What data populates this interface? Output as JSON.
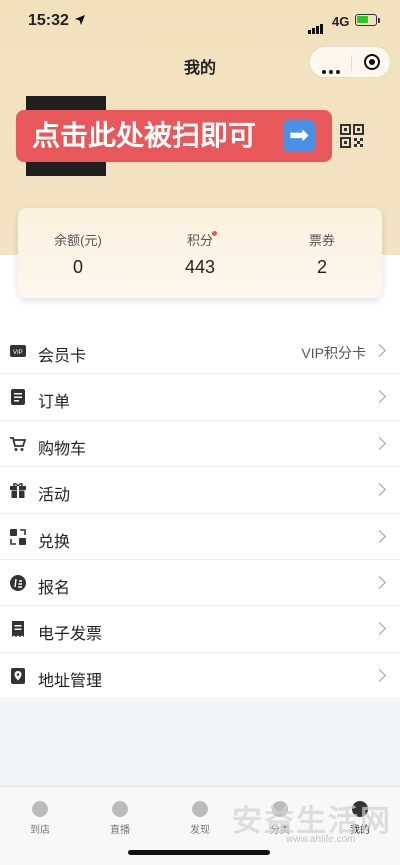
{
  "status_bar": {
    "time": "15:32",
    "network": "4G"
  },
  "header": {
    "title": "我的"
  },
  "banner": {
    "text": "点击此处被扫即可",
    "arrow": "➡"
  },
  "stats": [
    {
      "label": "余额(元)",
      "value": "0"
    },
    {
      "label": "积分",
      "value": "443",
      "has_dot": true
    },
    {
      "label": "票券",
      "value": "2"
    }
  ],
  "menu": [
    {
      "label": "会员卡",
      "right_text": "VIP积分卡",
      "icon": "vip-card-icon"
    },
    {
      "label": "订单",
      "icon": "order-icon"
    },
    {
      "label": "购物车",
      "icon": "cart-icon"
    },
    {
      "label": "活动",
      "icon": "gift-icon"
    },
    {
      "label": "兑换",
      "icon": "exchange-icon"
    },
    {
      "label": "报名",
      "icon": "signup-icon"
    },
    {
      "label": "电子发票",
      "icon": "invoice-icon"
    },
    {
      "label": "地址管理",
      "icon": "address-icon"
    }
  ],
  "tabs": [
    {
      "label": "到店",
      "icon": "store-icon"
    },
    {
      "label": "直播",
      "icon": "live-icon"
    },
    {
      "label": "发现",
      "icon": "discover-icon"
    },
    {
      "label": "分类",
      "icon": "category-icon"
    },
    {
      "label": "我的",
      "icon": "profile-icon",
      "active": true
    }
  ],
  "watermark": {
    "text": "安益生活网",
    "subtext": "www.ahlife.com"
  },
  "colors": {
    "banner": "#e8585a",
    "header_bg": "#f2e1bd",
    "arrow_box": "#4a90e2"
  }
}
